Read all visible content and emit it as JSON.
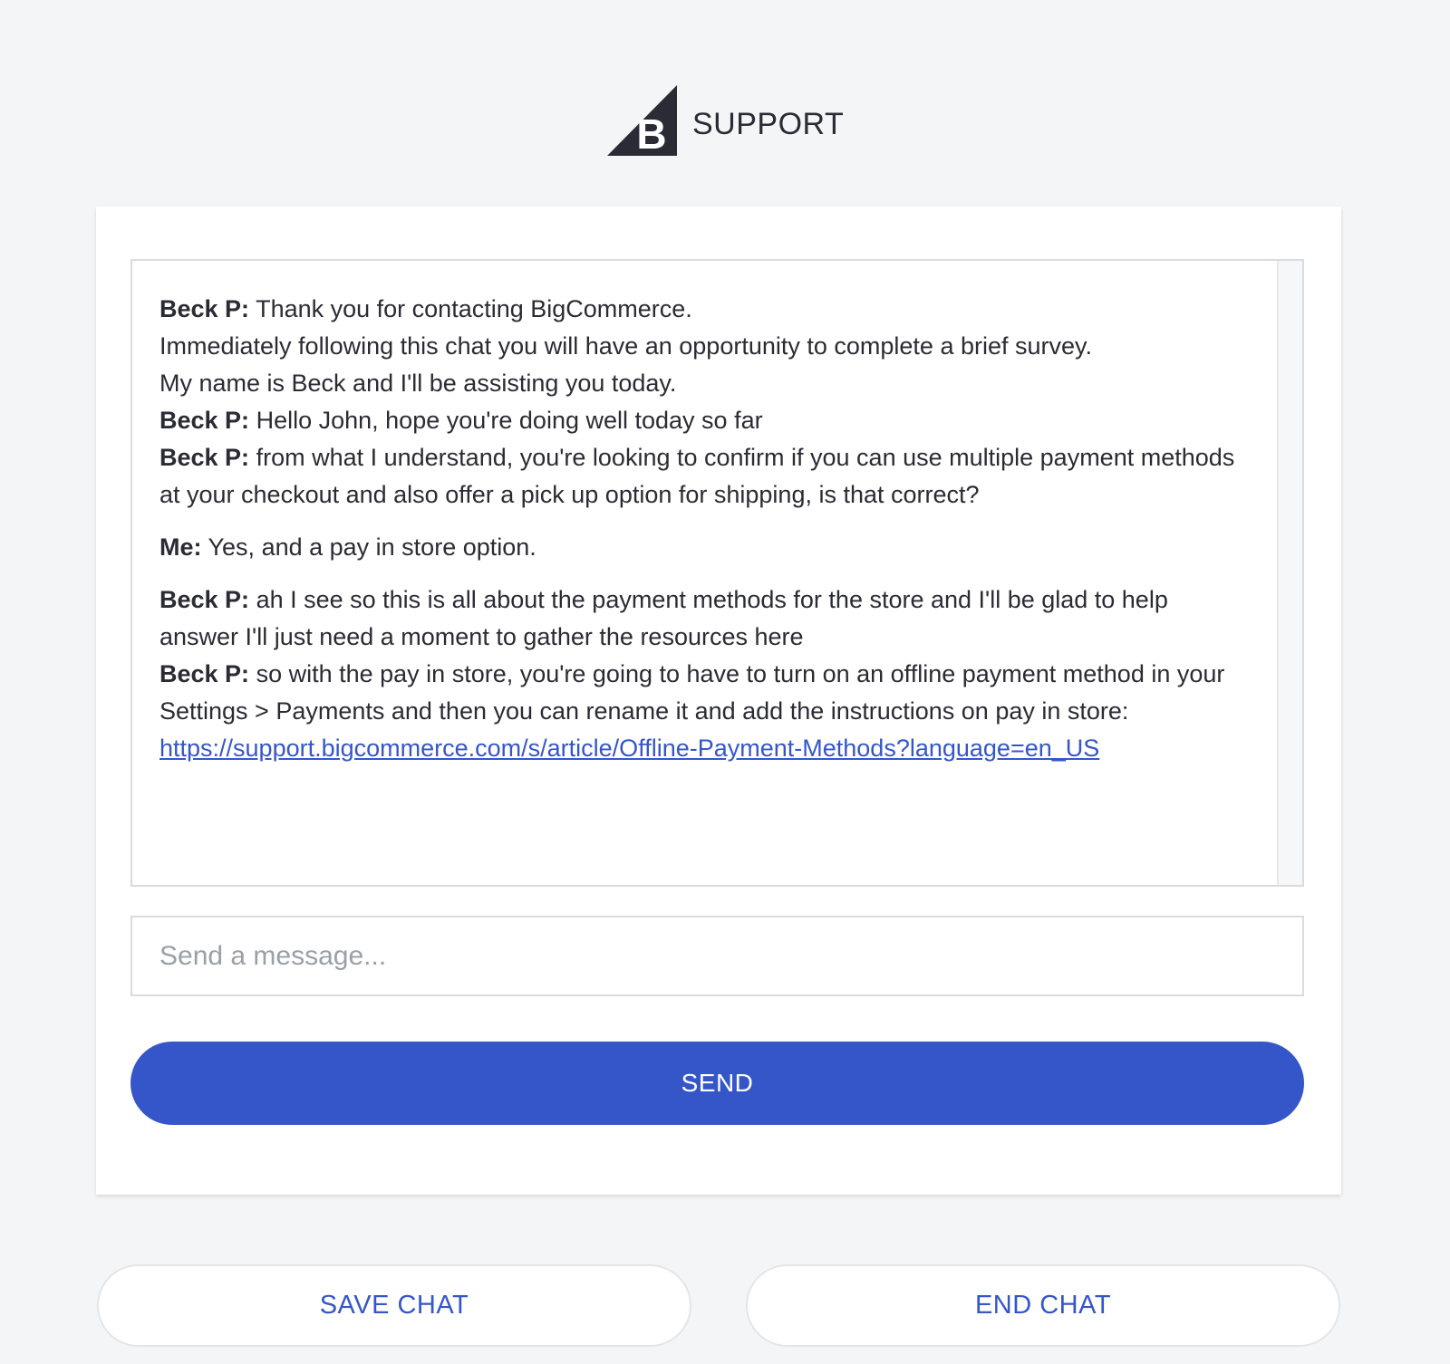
{
  "header": {
    "logo_icon": "bigcommerce-b-logo",
    "brand_text": "SUPPORT"
  },
  "transcript": {
    "messages": [
      {
        "sender": "Beck P:",
        "lines": [
          "Thank you for contacting BigCommerce.",
          "Immediately following this chat you will have an opportunity to complete a brief survey.",
          "My name is Beck and I'll be assisting you today."
        ]
      },
      {
        "sender": "Beck P:",
        "text": "Hello John, hope you're doing well today so far"
      },
      {
        "sender": "Beck P:",
        "text": "from what I understand, you're looking to confirm if you can use multiple payment methods at your checkout and also offer a pick up option for shipping, is that correct?"
      },
      {
        "sender": "Me:",
        "text": "Yes, and a pay in store option."
      },
      {
        "sender": "Beck P:",
        "text": "ah I see so this is all about the payment methods for the store and I'll be glad to help answer I'll just need a moment to gather the resources here"
      },
      {
        "sender": "Beck P:",
        "text": "so with the pay in store, you're going to have to turn on an offline payment method in your",
        "text2": "Settings > Payments and then you can rename it and add the instructions on pay in store:",
        "link": "https://support.bigcommerce.com/s/article/Offline-Payment-Methods?language=en_US"
      }
    ]
  },
  "composer": {
    "placeholder": "Send a message...",
    "value": ""
  },
  "buttons": {
    "send": "SEND",
    "save_chat": "SAVE CHAT",
    "end_chat": "END CHAT"
  },
  "colors": {
    "accent": "#3556c8",
    "background": "#f4f5f7",
    "text": "#2b2b35"
  }
}
